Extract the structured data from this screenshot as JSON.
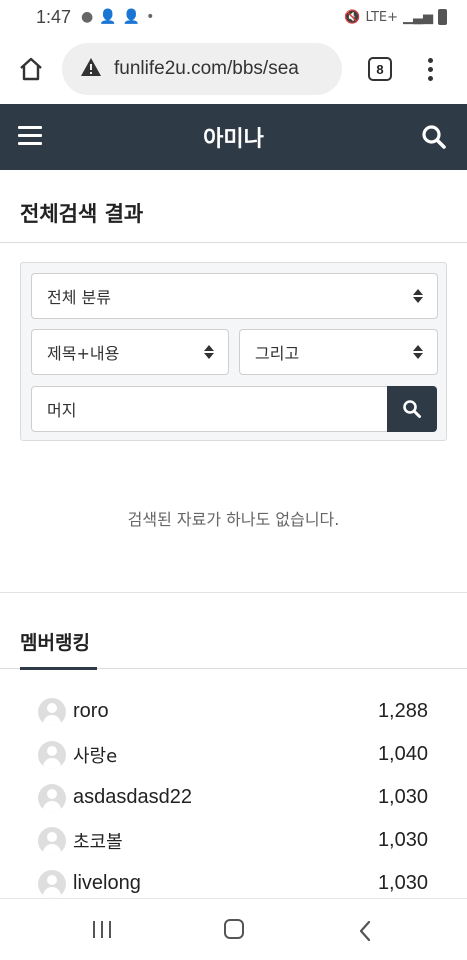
{
  "status_bar": {
    "time": "1:47",
    "network": "LTE+"
  },
  "browser": {
    "url": "funlife2u.com/bbs/sea",
    "tab_count": "8"
  },
  "site": {
    "title": "아미나"
  },
  "page": {
    "section_title": "전체검색 결과"
  },
  "search": {
    "category_select": "전체 분류",
    "field_select": "제목+내용",
    "operator_select": "그리고",
    "keyword": "머지",
    "empty_message": "검색된 자료가 하나도 없습니다."
  },
  "ranking": {
    "tab_label": "멤버랭킹",
    "members": [
      {
        "name": "roro",
        "score": "1,288"
      },
      {
        "name": "사랑e",
        "score": "1,040"
      },
      {
        "name": "asdasdasd22",
        "score": "1,030"
      },
      {
        "name": "초코볼",
        "score": "1,030"
      },
      {
        "name": "livelong",
        "score": "1,030"
      }
    ]
  },
  "icons": {
    "home": "home-icon",
    "warning": "warning-icon",
    "menu": "more-vert-icon",
    "hamburger": "hamburger-icon",
    "search": "search-icon",
    "avatar": "user-avatar-icon"
  },
  "colors": {
    "header_bg": "#2e3a45",
    "panel_bg": "#f5f6f7"
  }
}
